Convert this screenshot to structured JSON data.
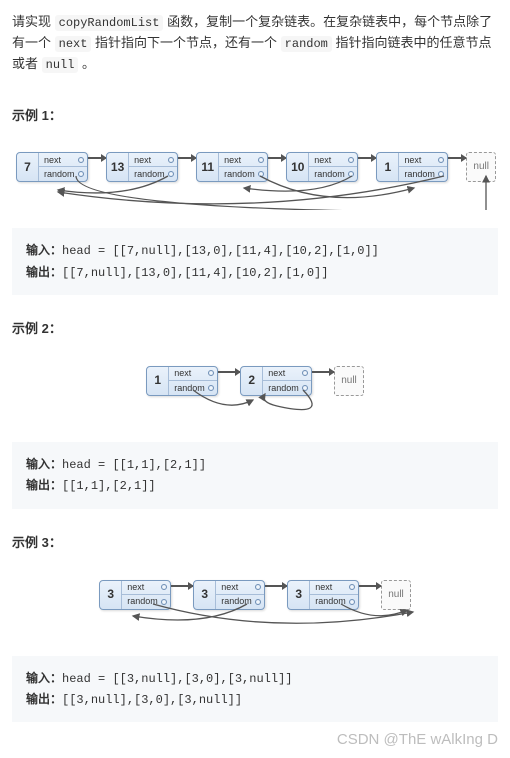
{
  "desc": {
    "p1a": "请实现 ",
    "fn": "copyRandomList",
    "p1b": " 函数，复制一个复杂链表。在复杂链表中，每个节点除了有一个 ",
    "kw_next": "next",
    "p1c": " 指针指向下一个节点，还有一个 ",
    "kw_random": "random",
    "p1d": " 指针指向链表中的任意节点或者 ",
    "kw_null": "null",
    "p1e": " 。"
  },
  "labels": {
    "next": "next",
    "random": "random",
    "null": "null",
    "input": "输入：",
    "output": "输出：",
    "head": "head = "
  },
  "ex1": {
    "title": "示例 1：",
    "nodes": [
      "7",
      "13",
      "11",
      "10",
      "1"
    ],
    "input": "[[7,null],[13,0],[11,4],[10,2],[1,0]]",
    "output": "[[7,null],[13,0],[11,4],[10,2],[1,0]]"
  },
  "ex2": {
    "title": "示例 2：",
    "nodes": [
      "1",
      "2"
    ],
    "input": "[[1,1],[2,1]]",
    "output": "[[1,1],[2,1]]"
  },
  "ex3": {
    "title": "示例 3：",
    "nodes": [
      "3",
      "3",
      "3"
    ],
    "input": "[[3,null],[3,0],[3,null]]",
    "output": "[[3,null],[3,0],[3,null]]"
  },
  "watermark": "CSDN @ThE wAlkIng D"
}
